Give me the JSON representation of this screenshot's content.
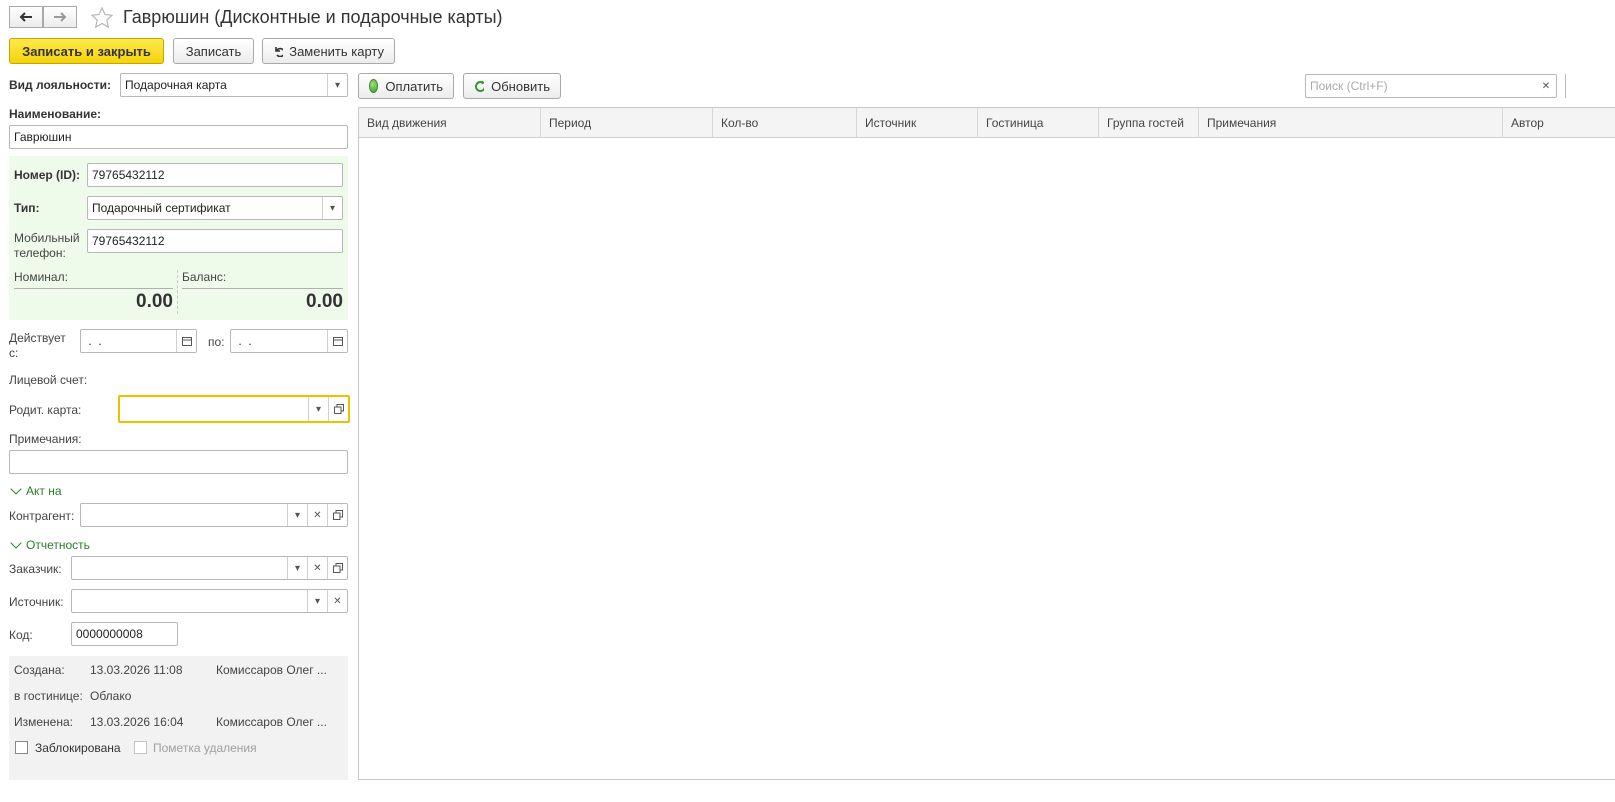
{
  "window": {
    "title": "Гаврюшин (Дисконтные и подарочные карты)"
  },
  "toolbar": {
    "save_close": "Записать и закрыть",
    "save": "Записать",
    "replace_card": "Заменить карту"
  },
  "form": {
    "loyalty_label": "Вид лояльности:",
    "loyalty_value": "Подарочная карта",
    "name_label": "Наименование:",
    "name_value": "Гаврюшин",
    "card_number_label": "Номер (ID):",
    "card_number_value": "79765432112",
    "type_label": "Тип:",
    "type_value": "Подарочный сертификат",
    "mobile_label_1": "Мобильный",
    "mobile_label_2": "телефон:",
    "mobile_value": "79765432112",
    "nominal_label": "Номинал:",
    "nominal_value": "0.00",
    "balance_label": "Баланс:",
    "balance_value": "0.00",
    "valid_from_label_1": "Действует",
    "valid_from_label_2": "с:",
    "valid_from_value": " .  .",
    "valid_to_label": "по:",
    "valid_to_value": " .  .",
    "account_label": "Лицевой счет:",
    "parent_card_label": "Родит. карта:",
    "parent_card_value": "",
    "notes_label": "Примечания:",
    "notes_value": "",
    "act_section": "Акт на",
    "counterparty_label": "Контрагент:",
    "counterparty_value": "",
    "reporting_section": "Отчетность",
    "customer_label": "Заказчик:",
    "customer_value": "",
    "source_label": "Источник:",
    "source_value": "",
    "code_label": "Код:",
    "code_value": "0000000008"
  },
  "info": {
    "created_label": "Создана:",
    "created_date": "13.03.2026 11:08",
    "created_by": "Комиссаров Олег ...",
    "hotel_label": "в гостинице:",
    "hotel_value": "Облако",
    "modified_label": "Изменена:",
    "modified_date": "13.03.2026 16:04",
    "modified_by": "Комиссаров Олег ...",
    "blocked_label": "Заблокирована",
    "blocked": false,
    "deletion_label": "Пометка удаления",
    "deletion": false
  },
  "right_toolbar": {
    "pay": "Оплатить",
    "refresh": "Обновить",
    "search_placeholder": "Поиск (Ctrl+F)"
  },
  "table": {
    "columns": [
      "Вид движения",
      "Период",
      "Кол-во",
      "Источник",
      "Гостиница",
      "Группа гостей",
      "Примечания",
      "Автор"
    ],
    "rows": []
  },
  "colors": {
    "primary_button": "#f5d30a",
    "green_panel": "#eefbea",
    "section_link": "#2a7d2a",
    "focus_border": "#f0c000"
  }
}
